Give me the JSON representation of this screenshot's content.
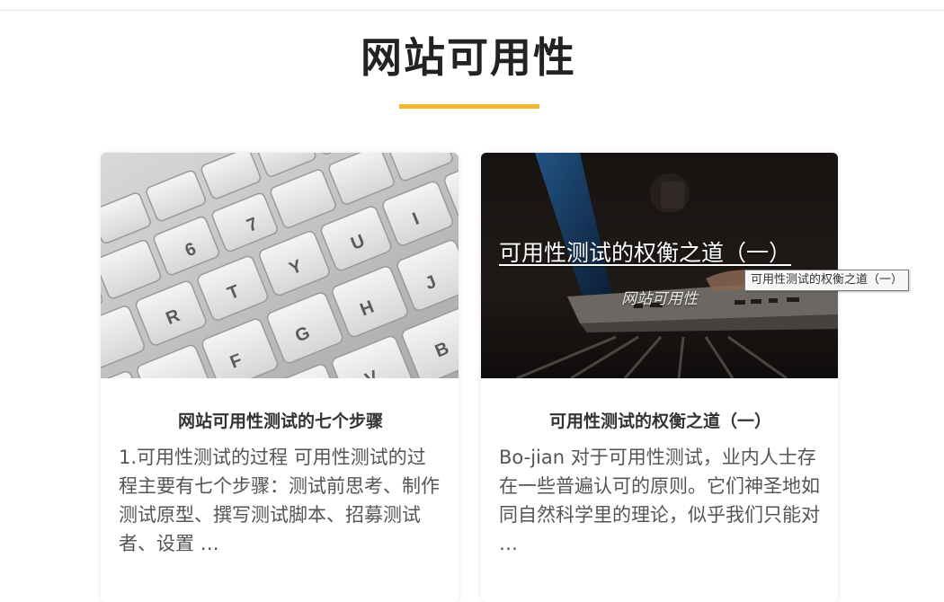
{
  "section": {
    "title": "网站可用性",
    "accent_color": "#f0b72f"
  },
  "cards": [
    {
      "image": "keyboard-photo",
      "title": "网站可用性测试的七个步骤",
      "excerpt": "1.可用性测试的过程 可用性测试的过程主要有七个步骤：测试前思考、制作测试原型、撰写测试脚本、招募测试者、设置 …"
    },
    {
      "image": "laptop-photo",
      "title": "可用性测试的权衡之道（一）",
      "overlay_title": "可用性测试的权衡之道（一）",
      "overlay_category": "网站可用性",
      "excerpt": "Bo-jian 对于可用性测试，业内人士存在一些普遍认可的原则。它们神圣地如同自然科学里的理论，似乎我们只能对 …"
    }
  ],
  "tooltip": {
    "text": "可用性测试的权衡之道（一）"
  }
}
